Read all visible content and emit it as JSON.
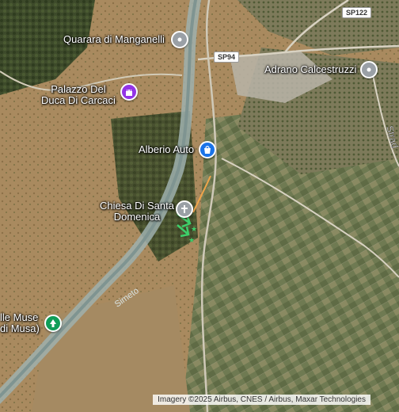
{
  "map": {
    "type": "satellite",
    "attribution": "Imagery ©2025 Airbus, CNES / Airbus, Maxar Technologies",
    "road_shields": [
      "SP122",
      "SP94"
    ],
    "road_labels": [
      "Strad",
      "Simeto"
    ],
    "river_color": "#9fb0ae",
    "pois": [
      {
        "name": "Quarara di Manganelli",
        "icon": "place-pin-icon",
        "color": "#9aa0a6"
      },
      {
        "name": "Adrano Calcestruzzi",
        "icon": "place-pin-icon",
        "color": "#9aa0a6"
      },
      {
        "name": "Palazzo Del Duca Di Carcaci",
        "line1": "Palazzo Del",
        "line2": "Duca Di Carcaci",
        "icon": "castle-icon",
        "color": "#9334e6"
      },
      {
        "name": "Alberio Auto",
        "icon": "shopping-bag-icon",
        "color": "#1a73e8"
      },
      {
        "name": "Chiesa Di Santa Domenica",
        "line1": "Chiesa Di Santa",
        "line2": "Domenica",
        "icon": "church-cross-icon",
        "color": "#9aa0a6"
      },
      {
        "name": "lle Muse (di Musa)",
        "line1": "lle Muse",
        "line2": "di Musa)",
        "icon": "park-tree-icon",
        "color": "#0f9d58"
      }
    ]
  }
}
